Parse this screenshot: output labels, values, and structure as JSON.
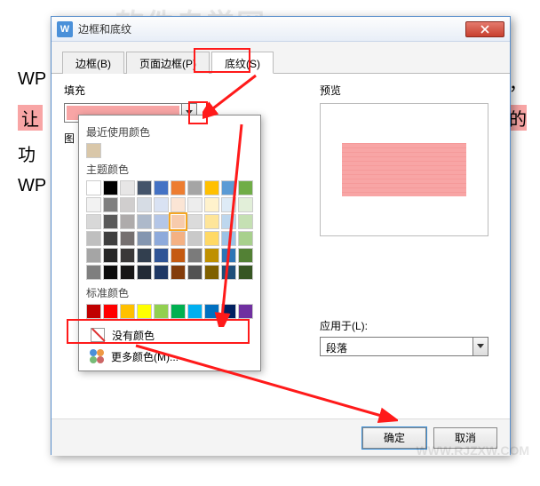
{
  "watermark": "软件自学网",
  "watermark_url": "WWW.RJZXW.COM",
  "bg": {
    "l1": "WP",
    "l2": "让",
    "l3": "功",
    "l4": "WP",
    "r1": "，",
    "r2": "的"
  },
  "dialog": {
    "app_icon": "W",
    "title": "边框和底纹",
    "tabs": {
      "border": "边框(B)",
      "page": "页面边框(P)",
      "shading": "底纹(S)"
    },
    "fill_label": "填充",
    "pattern_label": "图",
    "popup": {
      "recent": "最近使用颜色",
      "theme": "主题颜色",
      "standard": "标准颜色",
      "no_color": "没有颜色",
      "more": "更多颜色(M)..."
    },
    "preview_label": "预览",
    "apply_label": "应用于(L):",
    "apply_value": "段落",
    "ok": "确定",
    "cancel": "取消"
  },
  "chart_data": {
    "type": "table",
    "theme_colors_row1": [
      "#ffffff",
      "#000000",
      "#e7e6e6",
      "#44546a",
      "#4472c4",
      "#ed7d31",
      "#a5a5a5",
      "#ffc000",
      "#5b9bd5",
      "#70ad47"
    ],
    "theme_tints": [
      [
        "#f2f2f2",
        "#7f7f7f",
        "#d0cece",
        "#d6dce4",
        "#d9e2f3",
        "#fbe5d5",
        "#ededed",
        "#fff2cc",
        "#deebf6",
        "#e2efd9"
      ],
      [
        "#d8d8d8",
        "#595959",
        "#aeabab",
        "#adb9ca",
        "#b4c6e7",
        "#f7cbac",
        "#dbdbdb",
        "#fee599",
        "#bdd7ee",
        "#c5e0b3"
      ],
      [
        "#bfbfbf",
        "#3f3f3f",
        "#757070",
        "#8496b0",
        "#8eaadb",
        "#f4b183",
        "#c9c9c9",
        "#ffd965",
        "#9cc3e5",
        "#a8d08d"
      ],
      [
        "#a5a5a5",
        "#262626",
        "#3a3838",
        "#323f4f",
        "#2f5496",
        "#c55a11",
        "#7b7b7b",
        "#bf9000",
        "#2e75b5",
        "#538135"
      ],
      [
        "#7f7f7f",
        "#0c0c0c",
        "#171616",
        "#222a35",
        "#1f3864",
        "#833c0b",
        "#525252",
        "#7f6000",
        "#1e4e79",
        "#375623"
      ]
    ],
    "standard_colors": [
      "#c00000",
      "#ff0000",
      "#ffc000",
      "#ffff00",
      "#92d050",
      "#00b050",
      "#00b0f0",
      "#0070c0",
      "#002060",
      "#7030a0"
    ],
    "recent_colors": [
      "#d9c7a9"
    ],
    "selected_theme": {
      "row": 2,
      "col": 5
    }
  }
}
